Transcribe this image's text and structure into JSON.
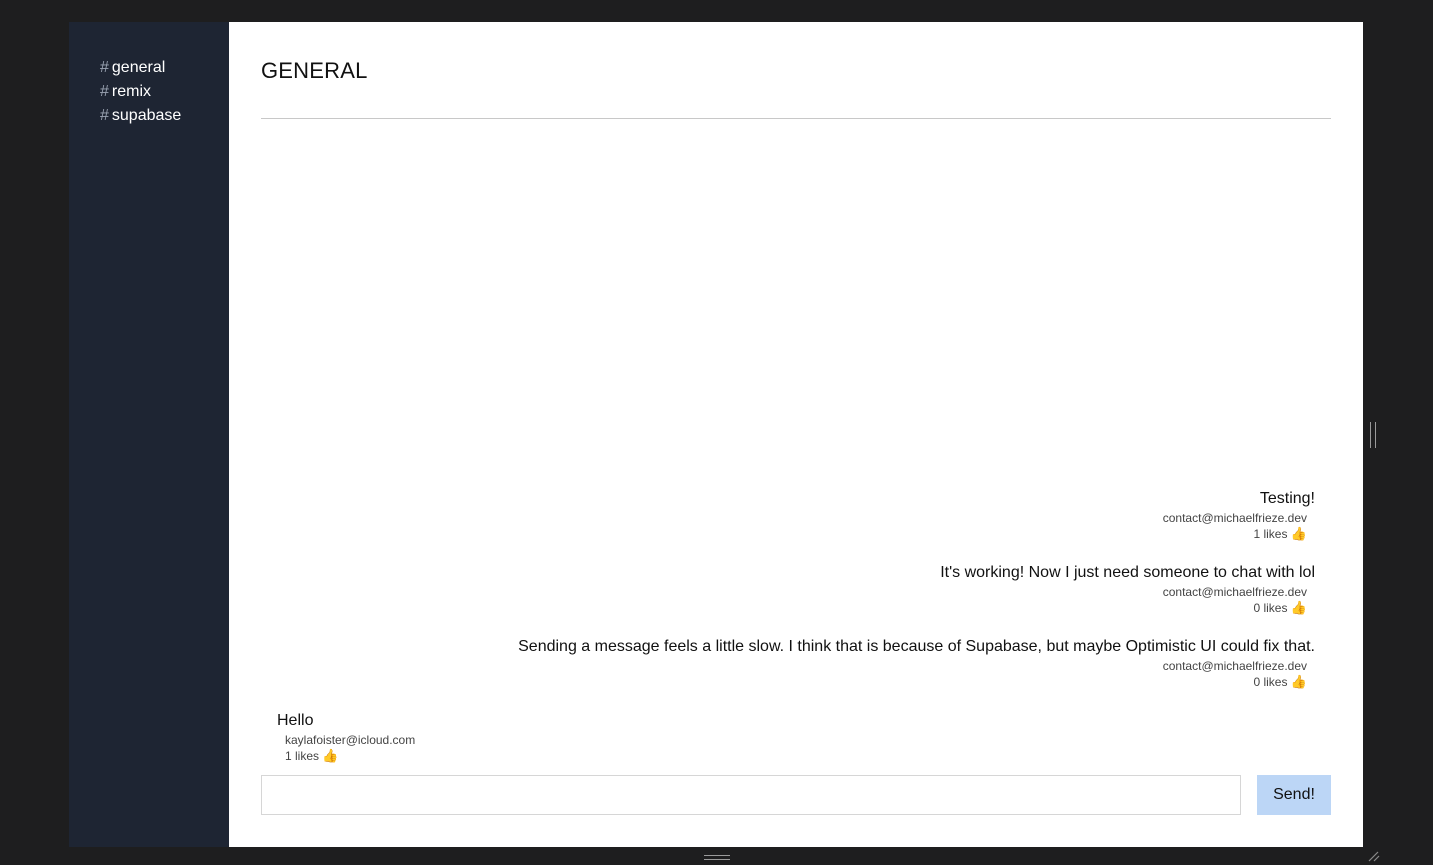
{
  "sidebar": {
    "channels": [
      {
        "hash": "#",
        "name": "general"
      },
      {
        "hash": "#",
        "name": "remix"
      },
      {
        "hash": "#",
        "name": "supabase"
      }
    ]
  },
  "main": {
    "title": "GENERAL",
    "messages": [
      {
        "text": "Testing!",
        "author": "contact@michaelfrieze.dev",
        "likes": "1 likes",
        "align": "right"
      },
      {
        "text": "It's working! Now I just need someone to chat with lol",
        "author": "contact@michaelfrieze.dev",
        "likes": "0 likes",
        "align": "right"
      },
      {
        "text": "Sending a message feels a little slow. I think that is because of Supabase, but maybe Optimistic UI could fix that.",
        "author": "contact@michaelfrieze.dev",
        "likes": "0 likes",
        "align": "right"
      },
      {
        "text": "Hello",
        "author": "kaylafoister@icloud.com",
        "likes": "1 likes",
        "align": "left"
      }
    ],
    "composer": {
      "input_value": "",
      "send_label": "Send!"
    }
  },
  "icons": {
    "like": "👍",
    "grip": "⁄⁄"
  },
  "colors": {
    "sidebar_bg": "#1e2533",
    "send_button": "#bcd6f6",
    "page_bg": "#1e1e1f"
  }
}
